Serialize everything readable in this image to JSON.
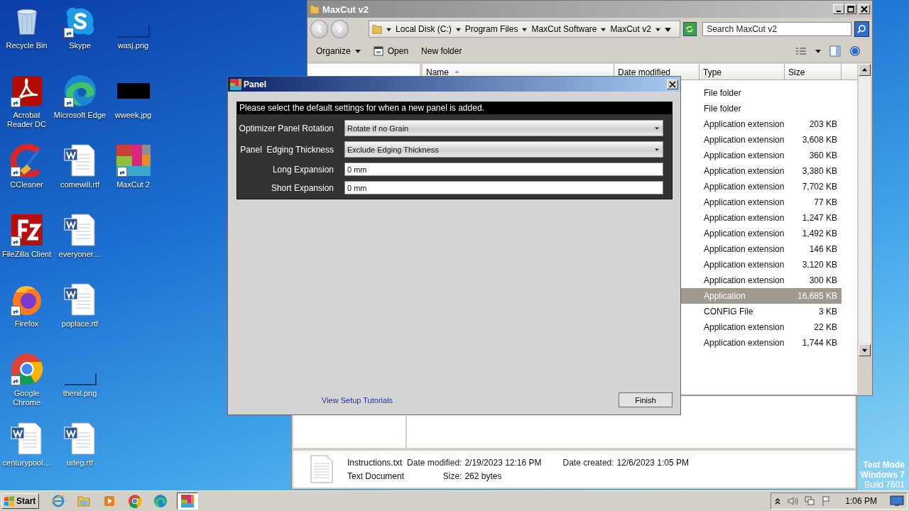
{
  "desktop": {
    "icons": [
      {
        "label": "Recycle Bin",
        "kind": "recycle",
        "shortcut": false
      },
      {
        "label": "Acrobat Reader DC",
        "kind": "acrobat",
        "shortcut": true
      },
      {
        "label": "CCleaner",
        "kind": "ccleaner",
        "shortcut": true
      },
      {
        "label": "FileZilla Client",
        "kind": "filezilla",
        "shortcut": true
      },
      {
        "label": "Firefox",
        "kind": "firefox",
        "shortcut": true
      },
      {
        "label": "Google Chrome",
        "kind": "chrome",
        "shortcut": true
      },
      {
        "label": "centurypool…",
        "kind": "word",
        "shortcut": false
      },
      {
        "label": "Skype",
        "kind": "skype",
        "shortcut": true
      },
      {
        "label": "Microsoft Edge",
        "kind": "edge",
        "shortcut": true
      },
      {
        "label": "comewill.rtf",
        "kind": "word",
        "shortcut": false
      },
      {
        "label": "everyoner…",
        "kind": "word",
        "shortcut": false
      },
      {
        "label": "poplace.rtf",
        "kind": "word",
        "shortcut": false
      },
      {
        "label": "thenil.png",
        "kind": "blank-image",
        "shortcut": false
      },
      {
        "label": "urleg.rtf",
        "kind": "word",
        "shortcut": false
      },
      {
        "label": "wasj.png",
        "kind": "blank-image",
        "shortcut": false
      },
      {
        "label": "wweek.jpg",
        "kind": "black-image",
        "shortcut": false
      },
      {
        "label": "MaxCut 2",
        "kind": "maxcut",
        "shortcut": true
      }
    ],
    "test_mode": [
      "Test Mode",
      "Windows 7",
      "Build 7601"
    ]
  },
  "explorer_back": {
    "details": {
      "file_name": "Instructions.txt",
      "file_type": "Text Document",
      "fields": [
        {
          "label": "Date modified:",
          "value": "2/19/2023 12:16 PM"
        },
        {
          "label": "Date created:",
          "value": "12/6/2023 1:05 PM"
        },
        {
          "label": "Size:",
          "value": "262 bytes"
        }
      ]
    }
  },
  "explorer": {
    "title": "MaxCut v2",
    "breadcrumb": [
      "Local Disk (C:)",
      "Program Files",
      "MaxCut Software",
      "MaxCut v2"
    ],
    "search": {
      "placeholder": "Search MaxCut v2"
    },
    "toolbar": [
      "Organize",
      "Open",
      "New folder"
    ],
    "columns": [
      "Name",
      "Date modified",
      "Type",
      "Size"
    ],
    "rows": [
      {
        "type": "File folder",
        "selected": false
      },
      {
        "type": "File folder",
        "selected": false
      },
      {
        "type": "Application extension",
        "size": "203 KB",
        "selected": false
      },
      {
        "type": "Application extension",
        "size": "3,608 KB",
        "selected": false
      },
      {
        "type": "Application extension",
        "size": "360 KB",
        "selected": false
      },
      {
        "type": "Application extension",
        "size": "3,380 KB",
        "selected": false
      },
      {
        "type": "Application extension",
        "size": "7,702 KB",
        "selected": false
      },
      {
        "type": "Application extension",
        "size": "77 KB",
        "selected": false
      },
      {
        "type": "Application extension",
        "size": "1,247 KB",
        "selected": false
      },
      {
        "type": "Application extension",
        "size": "1,492 KB",
        "selected": false
      },
      {
        "type": "Application extension",
        "size": "146 KB",
        "selected": false
      },
      {
        "type": "Application extension",
        "size": "3,120 KB",
        "selected": false
      },
      {
        "type": "Application extension",
        "size": "300 KB",
        "selected": false
      },
      {
        "type": "Application",
        "size": "16,685 KB",
        "selected": true
      },
      {
        "type": "CONFIG File",
        "size": "3 KB",
        "selected": false
      },
      {
        "type": "Application extension",
        "size": "22 KB",
        "selected": false
      },
      {
        "type": "Application extension",
        "size": "1,744 KB",
        "selected": false
      }
    ]
  },
  "dialog": {
    "title": "Panel",
    "heading": "Please select the default settings for when a new panel is added.",
    "fields": [
      {
        "label": "Optimizer Panel Rotation",
        "kind": "dropdown",
        "value": "Rotate if no Grain"
      },
      {
        "label": "Panel  Edging Thickness",
        "kind": "dropdown",
        "value": "Exclude Edging Thickness"
      },
      {
        "label": "Long Expansion",
        "kind": "text",
        "value": "0 mm"
      },
      {
        "label": "Short Expansion",
        "kind": "text",
        "value": "0 mm"
      }
    ],
    "link": "View Setup Tutorials",
    "button": "Finish"
  },
  "taskbar": {
    "start": "Start",
    "apps": [
      {
        "kind": "ie",
        "active": false
      },
      {
        "kind": "folder",
        "active": false
      },
      {
        "kind": "media",
        "active": false
      },
      {
        "kind": "chrome",
        "active": false
      },
      {
        "kind": "edge",
        "active": false
      },
      {
        "kind": "maxcut",
        "active": true
      }
    ],
    "clock": "1:06 PM"
  }
}
